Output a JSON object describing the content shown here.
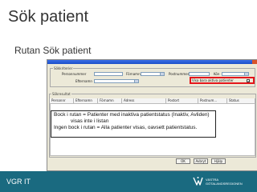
{
  "slide": {
    "title": "Sök patient",
    "subtitle": "Rutan Sök patient"
  },
  "window": {
    "search_group_label": "Sökkriterier",
    "fields": {
      "personnummer": "Personnummer",
      "fornamn": "Förnamn",
      "postnummer": "Postnummer",
      "efternamn": "Efternamn",
      "kon": "Kön"
    },
    "checkbox_label": "Visa bara aktiva patienter",
    "checkbox_mark": "✓",
    "results_group_label": "Sökresultat",
    "columns": [
      "Personnr",
      "Efternamn",
      "Förnamn",
      "Adress",
      "Postort",
      "Postnum...",
      "Status"
    ],
    "buttons": {
      "ok": "OK",
      "cancel": "Avbryt",
      "help": "Hjälp"
    }
  },
  "callout": {
    "line1": "Bock i rutan = Patienter med inaktiva patientstatus (Inaktiv, Avliden)",
    "line2": "visas inte i listan",
    "line3": "Ingen bock i rutan = Alla patienter visas, oavsett patientstatus."
  },
  "footer": {
    "left_text": "VGR IT",
    "logo_line1": "VÄSTRA",
    "logo_line2": "GÖTALANDSREGIONEN"
  },
  "colors": {
    "footer_bg": "#1a6a80",
    "highlight": "#e4161b",
    "title_text": "#333333"
  }
}
